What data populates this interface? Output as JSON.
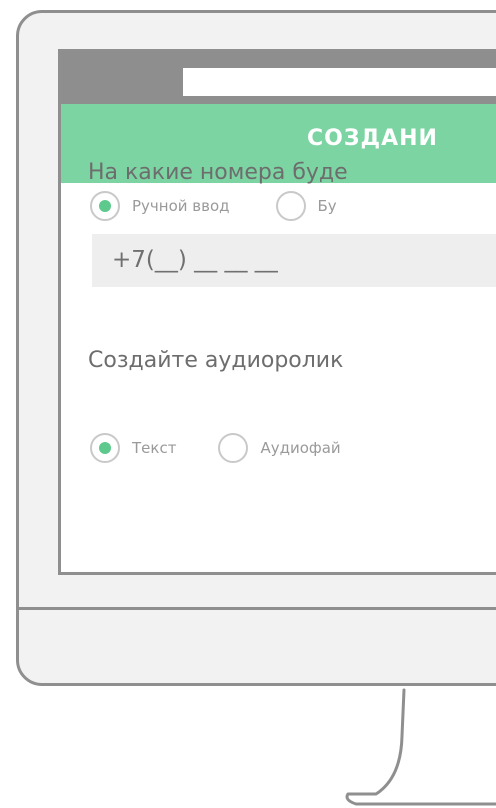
{
  "header": {
    "title": "СОЗДАНИ"
  },
  "phone_section": {
    "question": "На какие номера буде",
    "options": [
      {
        "label": "Ручной ввод",
        "selected": true
      },
      {
        "label": "Бу",
        "selected": false
      }
    ],
    "phone_input": {
      "value": "+7(__) __ __ __"
    }
  },
  "audio_section": {
    "question": "Создайте аудиоролик",
    "options": [
      {
        "label": "Текст",
        "selected": true
      },
      {
        "label": "Аудиофай",
        "selected": false
      }
    ]
  },
  "colors": {
    "accent": "#7dd4a3",
    "radio_dot": "#5dc98c",
    "frame": "#8f8f8f",
    "browser_bar": "#8e8e8e"
  }
}
